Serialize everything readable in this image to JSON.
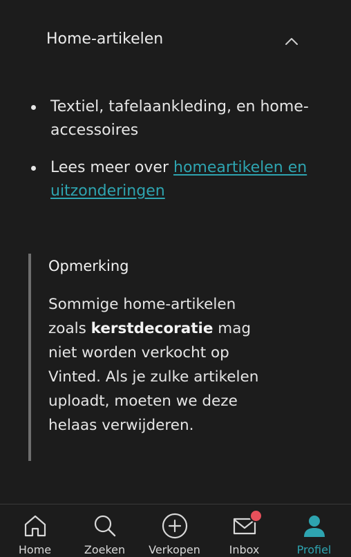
{
  "accordion": {
    "title": "Home-artikelen",
    "expanded": true
  },
  "bullets": {
    "item1": "Textiel, tafelaankleding, en home-accessoires",
    "item2_prefix": "Lees meer over ",
    "item2_link": "homeartikelen en uitzonderingen"
  },
  "note": {
    "title": "Opmerking",
    "body_part1": "Sommige home-artikelen zoals ",
    "body_bold": "kerstdecoratie",
    "body_part2": " mag niet worden verkocht op Vinted. Als je zulke artikelen uploadt, moeten we deze helaas verwijderen."
  },
  "nav": {
    "items": [
      {
        "label": "Home",
        "icon": "home-icon"
      },
      {
        "label": "Zoeken",
        "icon": "search-icon"
      },
      {
        "label": "Verkopen",
        "icon": "plus-circle-icon"
      },
      {
        "label": "Inbox",
        "icon": "mail-icon"
      },
      {
        "label": "Profiel",
        "icon": "profile-icon"
      }
    ],
    "active_index": 4,
    "inbox_has_notification": true
  },
  "colors": {
    "background": "#1c1c1c",
    "accent": "#2ea4b0",
    "badge": "#e8505b",
    "note_border": "#6e6e6e"
  }
}
